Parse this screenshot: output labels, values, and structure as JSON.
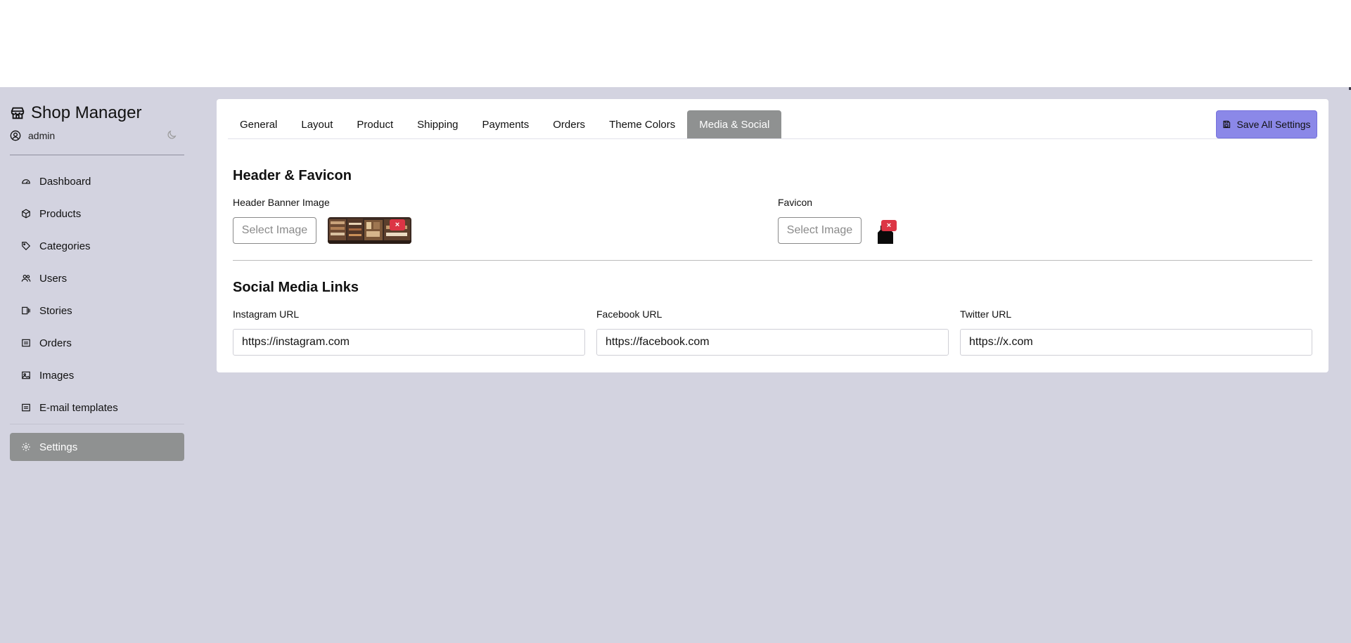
{
  "app": {
    "title": "Shop Manager",
    "user": "admin"
  },
  "sidebar": {
    "items": [
      {
        "label": "Dashboard",
        "icon": "dashboard-icon"
      },
      {
        "label": "Products",
        "icon": "box-icon"
      },
      {
        "label": "Categories",
        "icon": "tag-icon"
      },
      {
        "label": "Users",
        "icon": "users-icon"
      },
      {
        "label": "Stories",
        "icon": "stories-icon"
      },
      {
        "label": "Orders",
        "icon": "orders-icon"
      },
      {
        "label": "Images",
        "icon": "image-icon"
      },
      {
        "label": "E-mail templates",
        "icon": "email-icon"
      }
    ],
    "settings": {
      "label": "Settings",
      "icon": "gear-icon"
    }
  },
  "tabs": [
    "General",
    "Layout",
    "Product",
    "Shipping",
    "Payments",
    "Orders",
    "Theme Colors",
    "Media & Social"
  ],
  "active_tab": "Media & Social",
  "toolbar": {
    "save_label": "Save All Settings"
  },
  "header_section": {
    "title": "Header & Favicon",
    "banner_label": "Header Banner Image",
    "favicon_label": "Favicon",
    "select_label": "Select Image",
    "remove_label": "×"
  },
  "social_section": {
    "title": "Social Media Links",
    "instagram_label": "Instagram URL",
    "instagram_value": "https://instagram.com",
    "facebook_label": "Facebook URL",
    "facebook_value": "https://facebook.com",
    "twitter_label": "Twitter URL",
    "twitter_value": "https://x.com"
  },
  "colors": {
    "background": "#d3d3e0",
    "active_gray": "#8f9191",
    "save_accent": "#8b88e8",
    "remove_red": "#dc3545"
  }
}
